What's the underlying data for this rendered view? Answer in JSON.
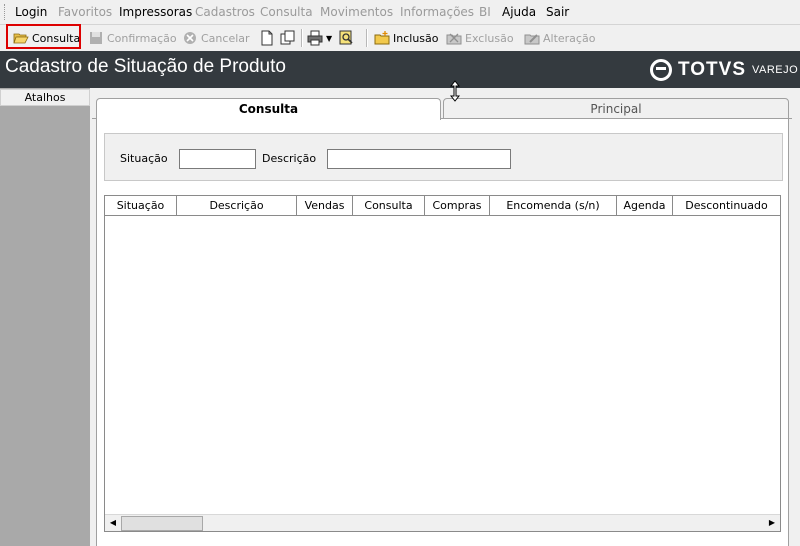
{
  "menu": [
    {
      "label": "Login",
      "disabled": false
    },
    {
      "label": "Favoritos",
      "disabled": true
    },
    {
      "label": "Impressoras",
      "disabled": false
    },
    {
      "label": "Cadastros",
      "disabled": true
    },
    {
      "label": "Consulta",
      "disabled": true
    },
    {
      "label": "Movimentos",
      "disabled": true
    },
    {
      "label": "Informações",
      "disabled": true
    },
    {
      "label": "BI",
      "disabled": true
    },
    {
      "label": "Ajuda",
      "disabled": false
    },
    {
      "label": "Sair",
      "disabled": false
    }
  ],
  "toolbar": {
    "consulta": "Consulta",
    "confirmacao": "Confirmação",
    "cancelar": "Cancelar",
    "inclusao": "Inclusão",
    "exclusao": "Exclusão",
    "alteracao": "Alteração"
  },
  "window": {
    "title": "Cadastro de Situação de Produto",
    "brand": "TOTVS",
    "brand_sub": "VAREJO"
  },
  "sidebar": {
    "header": "Atalhos"
  },
  "tabs": [
    {
      "label": "Consulta",
      "active": true
    },
    {
      "label": "Principal",
      "active": false
    }
  ],
  "filter": {
    "situacao_label": "Situação",
    "situacao_value": "",
    "descricao_label": "Descrição",
    "descricao_value": ""
  },
  "grid": {
    "columns": [
      "Situação",
      "Descrição",
      "Vendas",
      "Consulta",
      "Compras",
      "Encomenda (s/n)",
      "Agenda",
      "Descontinuado"
    ],
    "rows": []
  },
  "colors": {
    "titlebar": "#343a3f",
    "highlight": "#dd0000",
    "sidebar": "#a9a9a9"
  }
}
